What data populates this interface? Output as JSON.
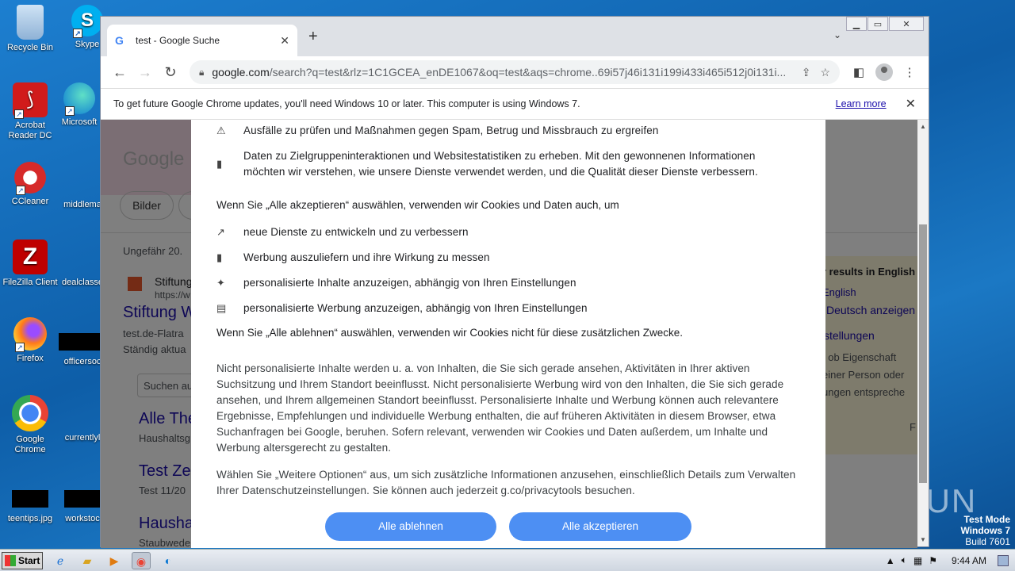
{
  "desktop": {
    "icons": [
      {
        "label": "Recycle Bin"
      },
      {
        "label": "Skype"
      },
      {
        "label": "Acrobat Reader DC"
      },
      {
        "label": "Microsoft"
      },
      {
        "label": "CCleaner"
      },
      {
        "label": "middlema"
      },
      {
        "label": "FileZilla Client"
      },
      {
        "label": "dealclasse"
      },
      {
        "label": "Firefox"
      },
      {
        "label": "officersoc"
      },
      {
        "label": "Google Chrome"
      },
      {
        "label": "currentlyl"
      },
      {
        "label": "teentips.jpg"
      },
      {
        "label": "workstoc"
      }
    ],
    "watermark": "ANY RUN",
    "test_mode": {
      "line1": "Test Mode",
      "line2": "Windows 7",
      "line3": "Build 7601"
    }
  },
  "browser": {
    "tab_title": "test - Google Suche",
    "url_host": "google.com",
    "url_path": "/search?q=test&rlz=1C1GCEA_enDE1067&oq=test&aqs=chrome..69i57j46i131i199i433i465i512j0i131i...",
    "infobar": {
      "message": "To get future Google Chrome updates, you'll need Windows 10 or later. This computer is using Windows 7.",
      "learn_more": "Learn more"
    }
  },
  "serp_background": {
    "chip": "Bilder",
    "result_count": "Ungefähr 20.",
    "r1_site": "Stiftung",
    "r1_url": "https://w",
    "r1_title": "Stiftung W",
    "r1_snip1": "test.de-Flatra",
    "r1_snip2": "Ständig aktua",
    "search_inside": "Suchen au",
    "r2_title": "Alle The",
    "r2_snip": "Haushaltsg",
    "r3_title": "Test Ze",
    "r3_snip": "Test 11/20",
    "r4_title": "Hausha",
    "r4_snip": "Staubwede",
    "side1": "r results in English",
    "side2": "English",
    "side3": "Deutsch anzeigen",
    "side4": "stellungen",
    "side5": ", ob Eigenschaft",
    "side6": "einer Person oder",
    "side7": "ungen entspreche",
    "side8": "F"
  },
  "consent": {
    "item_spam": "Ausfälle zu prüfen und Maßnahmen gegen Spam, Betrug und Missbrauch zu ergreifen",
    "item_stats": "Daten zu Zielgruppeninteraktionen und Websitestatistiken zu erheben. Mit den gewonnenen Informationen möchten wir verstehen, wie unsere Dienste verwendet werden, und die Qualität dieser Dienste verbessern.",
    "accept_heading": "Wenn Sie „Alle akzeptieren“ auswählen, verwenden wir Cookies und Daten auch, um",
    "item_develop": "neue Dienste zu entwickeln und zu verbessern",
    "item_ads": "Werbung auszuliefern und ihre Wirkung zu messen",
    "item_personal_content": "personalisierte Inhalte anzuzeigen, abhängig von Ihren Einstellungen",
    "item_personal_ads": "personalisierte Werbung anzuzeigen, abhängig von Ihren Einstellungen",
    "reject_heading": "Wenn Sie „Alle ablehnen“ auswählen, verwenden wir Cookies nicht für diese zusätzlichen Zwecke.",
    "para_nonpersonal": "Nicht personalisierte Inhalte werden u. a. von Inhalten, die Sie sich gerade ansehen, Aktivitäten in Ihrer aktiven Suchsitzung und Ihrem Standort beeinflusst. Nicht personalisierte Werbung wird von den Inhalten, die Sie sich gerade ansehen, und Ihrem allgemeinen Standort beeinflusst. Personalisierte Inhalte und Werbung können auch relevantere Ergebnisse, Empfehlungen und individuelle Werbung enthalten, die auf früheren Aktivitäten in diesem Browser, etwa Suchanfragen bei Google, beruhen. Sofern relevant, verwenden wir Cookies und Daten außerdem, um Inhalte und Werbung altersgerecht zu gestalten.",
    "para_more": "Wählen Sie „Weitere Optionen“ aus, um sich zusätzliche Informationen anzusehen, einschließlich Details zum Verwalten Ihrer Datenschutzeinstellungen. Sie können auch jederzeit g.co/privacytools besuchen.",
    "reject_button": "Alle ablehnen",
    "accept_button": "Alle akzeptieren"
  },
  "taskbar": {
    "start": "Start",
    "clock": "9:44 AM"
  },
  "colors": {
    "accent_button": "#4d8ff3",
    "link": "#1a0dab"
  }
}
